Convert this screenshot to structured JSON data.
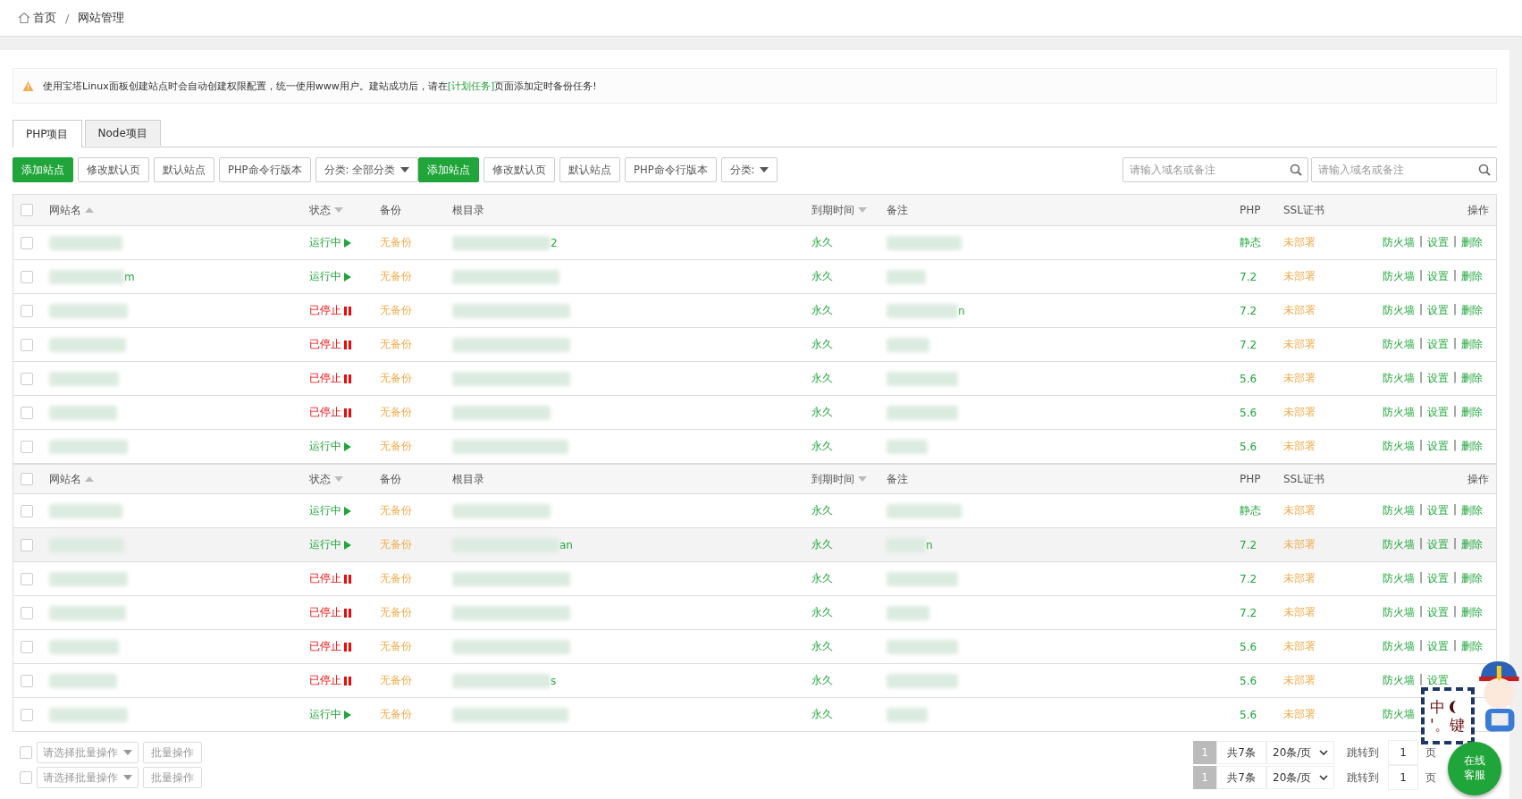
{
  "breadcrumb": {
    "items": [
      {
        "label": "首页",
        "kind": "home"
      },
      {
        "label": "网站管理",
        "kind": "page"
      }
    ],
    "separator": "/"
  },
  "notice": {
    "before": "使用宝塔Linux面板创建站点时会自动创建权限配置，统一使用www用户。建站成功后，请在",
    "link": "[计划任务]",
    "after": "页面添加定时备份任务!"
  },
  "tabs": [
    {
      "label": "PHP项目",
      "selected": true
    },
    {
      "label": "Node项目",
      "selected": false
    }
  ],
  "toolbar": [
    {
      "label": "添加站点",
      "kind": "primary"
    },
    {
      "label": "修改默认页",
      "kind": "default"
    },
    {
      "label": "默认站点",
      "kind": "default"
    },
    {
      "label": "PHP命令行版本",
      "kind": "default"
    },
    {
      "label": "分类: 全部分类",
      "kind": "dropdown"
    },
    {
      "label": "添加站点",
      "kind": "primary"
    },
    {
      "label": "修改默认页",
      "kind": "default"
    },
    {
      "label": "默认站点",
      "kind": "default"
    },
    {
      "label": "PHP命令行版本",
      "kind": "default"
    },
    {
      "label": "分类:",
      "kind": "dropdown"
    }
  ],
  "searches": [
    {
      "placeholder": "请输入域名或备注"
    },
    {
      "placeholder": "请输入域名或备注"
    }
  ],
  "tables": [
    {
      "all_checked": false,
      "columns": [
        {
          "label": "网站名",
          "sortable": true,
          "ascending": true
        },
        {
          "label": "状态",
          "sortable": true,
          "ascending": false
        },
        {
          "label": "备份"
        },
        {
          "label": "根目录"
        },
        {
          "label": "到期时间",
          "sortable": true,
          "ascending": false
        },
        {
          "label": "备注"
        },
        {
          "label": "PHP"
        },
        {
          "label": "SSL证书"
        },
        {
          "label": "操作"
        }
      ],
      "rows": [
        {
          "checked": false,
          "hovered": false,
          "status": {
            "kind": "running",
            "label": "运行中"
          },
          "backup": "无备份",
          "root_fragment": "2",
          "expiry": "永久",
          "php": "静态",
          "ssl": "未部署",
          "actions": [
            "防火墙",
            "设置",
            "删除"
          ]
        },
        {
          "checked": false,
          "hovered": false,
          "name_fragment": "m",
          "status": {
            "kind": "running",
            "label": "运行中"
          },
          "backup": "无备份",
          "expiry": "永久",
          "php": "7.2",
          "ssl": "未部署",
          "actions": [
            "防火墙",
            "设置",
            "删除"
          ]
        },
        {
          "checked": false,
          "hovered": false,
          "status": {
            "kind": "stopped",
            "label": "已停止"
          },
          "backup": "无备份",
          "expiry": "永久",
          "note_fragment": "n",
          "php": "7.2",
          "ssl": "未部署",
          "actions": [
            "防火墙",
            "设置",
            "删除"
          ]
        },
        {
          "checked": false,
          "hovered": false,
          "status": {
            "kind": "stopped",
            "label": "已停止"
          },
          "backup": "无备份",
          "expiry": "永久",
          "php": "7.2",
          "ssl": "未部署",
          "actions": [
            "防火墙",
            "设置",
            "删除"
          ]
        },
        {
          "checked": false,
          "hovered": false,
          "status": {
            "kind": "stopped",
            "label": "已停止"
          },
          "backup": "无备份",
          "expiry": "永久",
          "php": "5.6",
          "ssl": "未部署",
          "actions": [
            "防火墙",
            "设置",
            "删除"
          ]
        },
        {
          "checked": false,
          "hovered": false,
          "status": {
            "kind": "stopped",
            "label": "已停止"
          },
          "backup": "无备份",
          "expiry": "永久",
          "php": "5.6",
          "ssl": "未部署",
          "actions": [
            "防火墙",
            "设置",
            "删除"
          ]
        },
        {
          "checked": false,
          "hovered": false,
          "status": {
            "kind": "running",
            "label": "运行中"
          },
          "backup": "无备份",
          "expiry": "永久",
          "php": "5.6",
          "ssl": "未部署",
          "actions": [
            "防火墙",
            "设置",
            "删除"
          ]
        }
      ]
    },
    {
      "all_checked": false,
      "columns": [
        {
          "label": "网站名",
          "sortable": true,
          "ascending": true
        },
        {
          "label": "状态",
          "sortable": true,
          "ascending": false
        },
        {
          "label": "备份"
        },
        {
          "label": "根目录"
        },
        {
          "label": "到期时间",
          "sortable": true,
          "ascending": false
        },
        {
          "label": "备注"
        },
        {
          "label": "PHP"
        },
        {
          "label": "SSL证书"
        },
        {
          "label": "操作"
        }
      ],
      "rows": [
        {
          "checked": false,
          "hovered": false,
          "status": {
            "kind": "running",
            "label": "运行中"
          },
          "backup": "无备份",
          "expiry": "永久",
          "php": "静态",
          "ssl": "未部署",
          "actions": [
            "防火墙",
            "设置",
            "删除"
          ]
        },
        {
          "checked": false,
          "hovered": true,
          "status": {
            "kind": "running",
            "label": "运行中"
          },
          "backup": "无备份",
          "root_fragment": "an",
          "expiry": "永久",
          "note_fragment": "n",
          "php": "7.2",
          "ssl": "未部署",
          "actions": [
            "防火墙",
            "设置",
            "删除"
          ]
        },
        {
          "checked": false,
          "hovered": false,
          "status": {
            "kind": "stopped",
            "label": "已停止"
          },
          "backup": "无备份",
          "expiry": "永久",
          "php": "7.2",
          "ssl": "未部署",
          "actions": [
            "防火墙",
            "设置",
            "删除"
          ]
        },
        {
          "checked": false,
          "hovered": false,
          "status": {
            "kind": "stopped",
            "label": "已停止"
          },
          "backup": "无备份",
          "expiry": "永久",
          "php": "7.2",
          "ssl": "未部署",
          "actions": [
            "防火墙",
            "设置",
            "删除"
          ]
        },
        {
          "checked": false,
          "hovered": false,
          "status": {
            "kind": "stopped",
            "label": "已停止"
          },
          "backup": "无备份",
          "expiry": "永久",
          "php": "5.6",
          "ssl": "未部署",
          "actions": [
            "防火墙",
            "设置",
            "删除"
          ]
        },
        {
          "checked": false,
          "hovered": false,
          "status": {
            "kind": "stopped",
            "label": "已停止"
          },
          "backup": "无备份",
          "root_fragment": "s",
          "expiry": "永久",
          "php": "5.6",
          "ssl": "未部署",
          "actions": [
            "防火墙",
            "设置"
          ]
        },
        {
          "checked": false,
          "hovered": false,
          "status": {
            "kind": "running",
            "label": "运行中"
          },
          "backup": "无备份",
          "expiry": "永久",
          "php": "5.6",
          "ssl": "未部署",
          "actions": [
            "防火墙"
          ]
        }
      ]
    }
  ],
  "action_separator": "|",
  "batch": [
    {
      "checked": false,
      "placeholder": "请选择批量操作",
      "button": "批量操作"
    },
    {
      "checked": false,
      "placeholder": "请选择批量操作",
      "button": "批量操作"
    }
  ],
  "pagination": [
    {
      "current": "1",
      "total": "共7条",
      "page_size": "20条/页",
      "jump_label": "跳转到",
      "jump_value": "1",
      "page_unit": "页"
    },
    {
      "current": "1",
      "total": "共7条",
      "page_size": "20条/页",
      "jump_label": "跳转到",
      "jump_value": "1",
      "page_unit": "页"
    }
  ],
  "mascot": {
    "lines": [
      "中",
      "'。键"
    ]
  },
  "chat_button": "在线客服"
}
